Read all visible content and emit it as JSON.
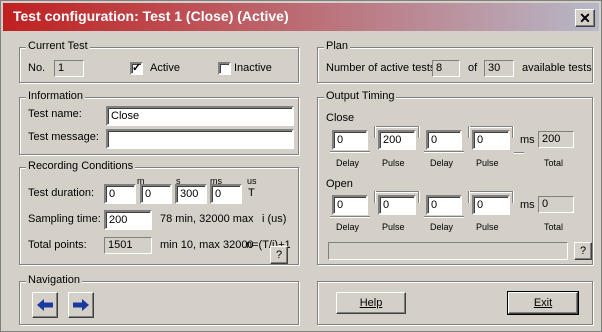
{
  "title": "Test configuration: Test 1 (Close) (Active)",
  "current_test": {
    "legend": "Current Test",
    "no_label": "No.",
    "no_value": "1",
    "active_label": "Active",
    "active_checked": true,
    "inactive_label": "Inactive",
    "inactive_checked": false
  },
  "information": {
    "legend": "Information",
    "test_name_label": "Test name:",
    "test_name_value": "Close",
    "test_message_label": "Test message:",
    "test_message_value": ""
  },
  "recording": {
    "legend": "Recording Conditions",
    "duration_label": "Test duration:",
    "hdr_m": "m",
    "hdr_s": "s",
    "hdr_ms": "ms",
    "hdr_us": "us",
    "dur_m": "0",
    "dur_s": "0",
    "dur_ms": "300",
    "dur_us": "0",
    "dur_unit": "T",
    "sampling_label": "Sampling time:",
    "sampling_value": "200",
    "sampling_hint": "78 min, 32000 max",
    "sampling_unit": "i (us)",
    "total_label": "Total points:",
    "total_value": "1501",
    "total_hint": "min 10, max 32000",
    "total_formula": "n=(T/i)+1",
    "help_label": "?"
  },
  "plan": {
    "legend": "Plan",
    "active_tests_label": "Number of active tests:",
    "active_tests_value": "8",
    "of_label": "of",
    "available_value": "30",
    "available_label": "available tests"
  },
  "output_timing": {
    "legend": "Output Timing",
    "close_label": "Close",
    "open_label": "Open",
    "close": {
      "delay1": "0",
      "pulse1": "200",
      "delay2": "0",
      "pulse2": "0",
      "total": "200"
    },
    "open": {
      "delay1": "0",
      "pulse1": "0",
      "delay2": "0",
      "pulse2": "0",
      "total": "0"
    },
    "col_delay": "Delay",
    "col_pulse": "Pulse",
    "col_total": "Total",
    "unit_ms": "ms",
    "help_label": "?"
  },
  "navigation": {
    "legend": "Navigation",
    "back_icon": "arrow-left-icon",
    "forward_icon": "arrow-right-icon"
  },
  "footer": {
    "help_button": "Help",
    "exit_button": "Exit"
  }
}
